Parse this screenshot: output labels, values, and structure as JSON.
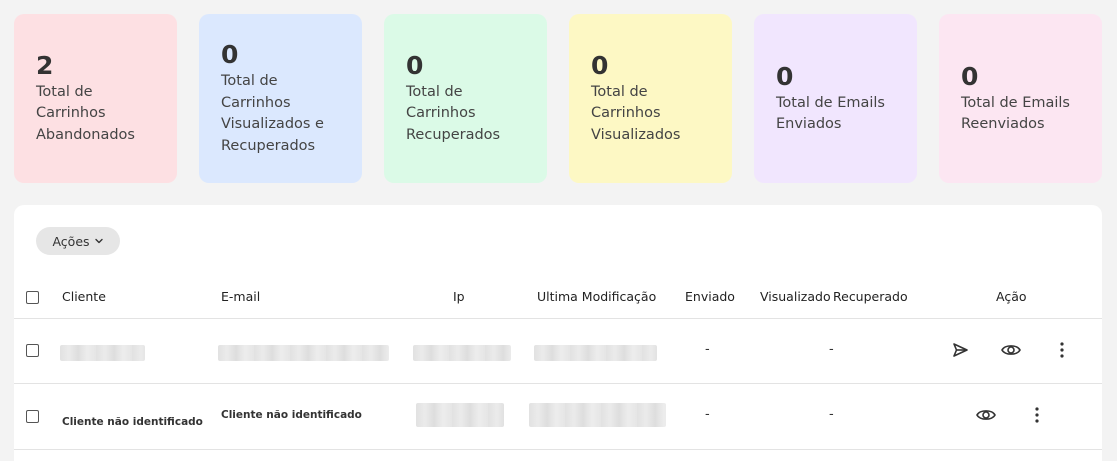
{
  "stats": [
    {
      "value": "2",
      "label": "Total de Carrinhos Abandonados",
      "bg": "#fde0e3"
    },
    {
      "value": "0",
      "label": "Total de Carrinhos Visualizados e Recuperados",
      "bg": "#dbe8fe"
    },
    {
      "value": "0",
      "label": "Total de Carrinhos Recuperados",
      "bg": "#dbfae7"
    },
    {
      "value": "0",
      "label": "Total de Carrinhos Visualizados",
      "bg": "#fdf8c4"
    },
    {
      "value": "0",
      "label": "Total de Emails Enviados",
      "bg": "#f1e6fe"
    },
    {
      "value": "0",
      "label": "Total de Emails Reenviados",
      "bg": "#fce6f2"
    }
  ],
  "toolbar": {
    "actions_label": "Ações"
  },
  "table": {
    "headers": {
      "cliente": "Cliente",
      "email": "E-mail",
      "ip": "Ip",
      "modificacao": "Ultima Modificação",
      "enviado": "Enviado",
      "visualizado": "Visualizado",
      "recuperado": "Recuperado",
      "acao": "Ação"
    },
    "rows": [
      {
        "cliente": "",
        "email": "",
        "ip": "",
        "modificacao": "",
        "enviado": "-",
        "visualizado_recuperado": "-",
        "actions": [
          "send-icon",
          "eye-icon",
          "more-vertical-icon"
        ]
      },
      {
        "cliente": "Cliente não identificado",
        "email": "Cliente não identificado",
        "ip": "",
        "modificacao": "",
        "enviado": "-",
        "visualizado_recuperado": "-",
        "actions": [
          "eye-icon",
          "more-vertical-icon"
        ]
      }
    ]
  }
}
